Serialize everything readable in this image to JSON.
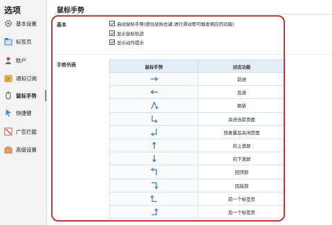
{
  "sidebar": {
    "title": "选项",
    "items": [
      {
        "label": "基本设置",
        "icon": "gear-icon",
        "color": "#5a6a7a"
      },
      {
        "label": "标签页",
        "icon": "tabs-icon",
        "color": "#4a7fc1"
      },
      {
        "label": "账户",
        "icon": "account-icon",
        "color": "#c0503c"
      },
      {
        "label": "通知订阅",
        "icon": "bell-icon",
        "color": "#d9892a"
      },
      {
        "label": "鼠标手势",
        "icon": "mouse-gesture-icon",
        "color": "#444444"
      },
      {
        "label": "快捷键",
        "icon": "keyboard-icon",
        "color": "#3a8fd0"
      },
      {
        "label": "广告拦截",
        "icon": "ad-block-icon",
        "color": "#c94a3a"
      },
      {
        "label": "高级设置",
        "icon": "toolbox-icon",
        "color": "#c0763a"
      }
    ],
    "active_index": 4
  },
  "main": {
    "title": "鼠标手势",
    "sections": {
      "basic_label": "基本",
      "gesture_list_label": "手势列表"
    },
    "options": [
      {
        "label": "启动鼠标手势(按住鼠标右键,进行滑动即可触发相应的功能)",
        "checked": true
      },
      {
        "label": "显示鼠标轨迹",
        "checked": true
      },
      {
        "label": "显示动作提示",
        "checked": true
      }
    ],
    "table": {
      "headers": [
        "鼠标手势",
        "对应功能"
      ],
      "rows": [
        {
          "gesture": "right",
          "function": "前进"
        },
        {
          "gesture": "left",
          "function": "后退"
        },
        {
          "gesture": "up-down",
          "function": "刷新"
        },
        {
          "gesture": "down-right",
          "function": "关闭当前页面"
        },
        {
          "gesture": "down-left",
          "function": "恢复最后关闭页面"
        },
        {
          "gesture": "up",
          "function": "向上滚屏"
        },
        {
          "gesture": "down",
          "function": "向下滚屏"
        },
        {
          "gesture": "up-left",
          "function": "回顶部"
        },
        {
          "gesture": "right-down",
          "function": "回底部"
        },
        {
          "gesture": "left-up",
          "function": "前一个标签页"
        },
        {
          "gesture": "right-up",
          "function": "后一个标签页"
        }
      ]
    }
  },
  "colors": {
    "accent_outline": "#b23a3a",
    "table_header_bg": "#e4eef7",
    "arrow": "#3f7fb3"
  }
}
